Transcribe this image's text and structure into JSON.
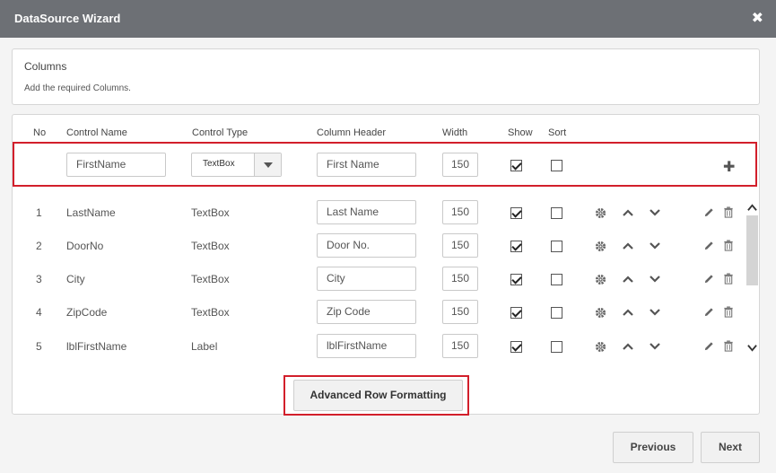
{
  "window": {
    "title": "DataSource Wizard",
    "close_glyph": "✖"
  },
  "columns_panel": {
    "title": "Columns",
    "subtitle": "Add the required Columns."
  },
  "headers": {
    "no": "No",
    "control_name": "Control Name",
    "control_type": "Control Type",
    "column_header": "Column Header",
    "width": "Width",
    "show": "Show",
    "sort": "Sort"
  },
  "new_row": {
    "control_name": "FirstName",
    "control_type": "TextBox",
    "column_header": "First Name",
    "width": "150",
    "show": true,
    "sort": false,
    "add_glyph": "✚"
  },
  "rows": [
    {
      "no": "1",
      "control_name": "LastName",
      "control_type": "TextBox",
      "column_header": "Last Name",
      "width": "150",
      "show": true,
      "sort": false
    },
    {
      "no": "2",
      "control_name": "DoorNo",
      "control_type": "TextBox",
      "column_header": "Door No.",
      "width": "150",
      "show": true,
      "sort": false
    },
    {
      "no": "3",
      "control_name": "City",
      "control_type": "TextBox",
      "column_header": "City",
      "width": "150",
      "show": true,
      "sort": false
    },
    {
      "no": "4",
      "control_name": "ZipCode",
      "control_type": "TextBox",
      "column_header": "Zip Code",
      "width": "150",
      "show": true,
      "sort": false
    },
    {
      "no": "5",
      "control_name": "lblFirstName",
      "control_type": "Label",
      "column_header": "lblFirstName",
      "width": "150",
      "show": true,
      "sort": false
    }
  ],
  "icons": {
    "settings": "gear-icon",
    "move_up": "chevron-up-icon",
    "move_down": "chevron-down-icon",
    "edit": "pencil-icon",
    "delete": "trash-icon",
    "add": "plus-icon"
  },
  "advanced_button": "Advanced Row Formatting",
  "footer": {
    "previous": "Previous",
    "next": "Next"
  },
  "colors": {
    "titlebar": "#6d7075",
    "highlight": "#d21f2b"
  }
}
